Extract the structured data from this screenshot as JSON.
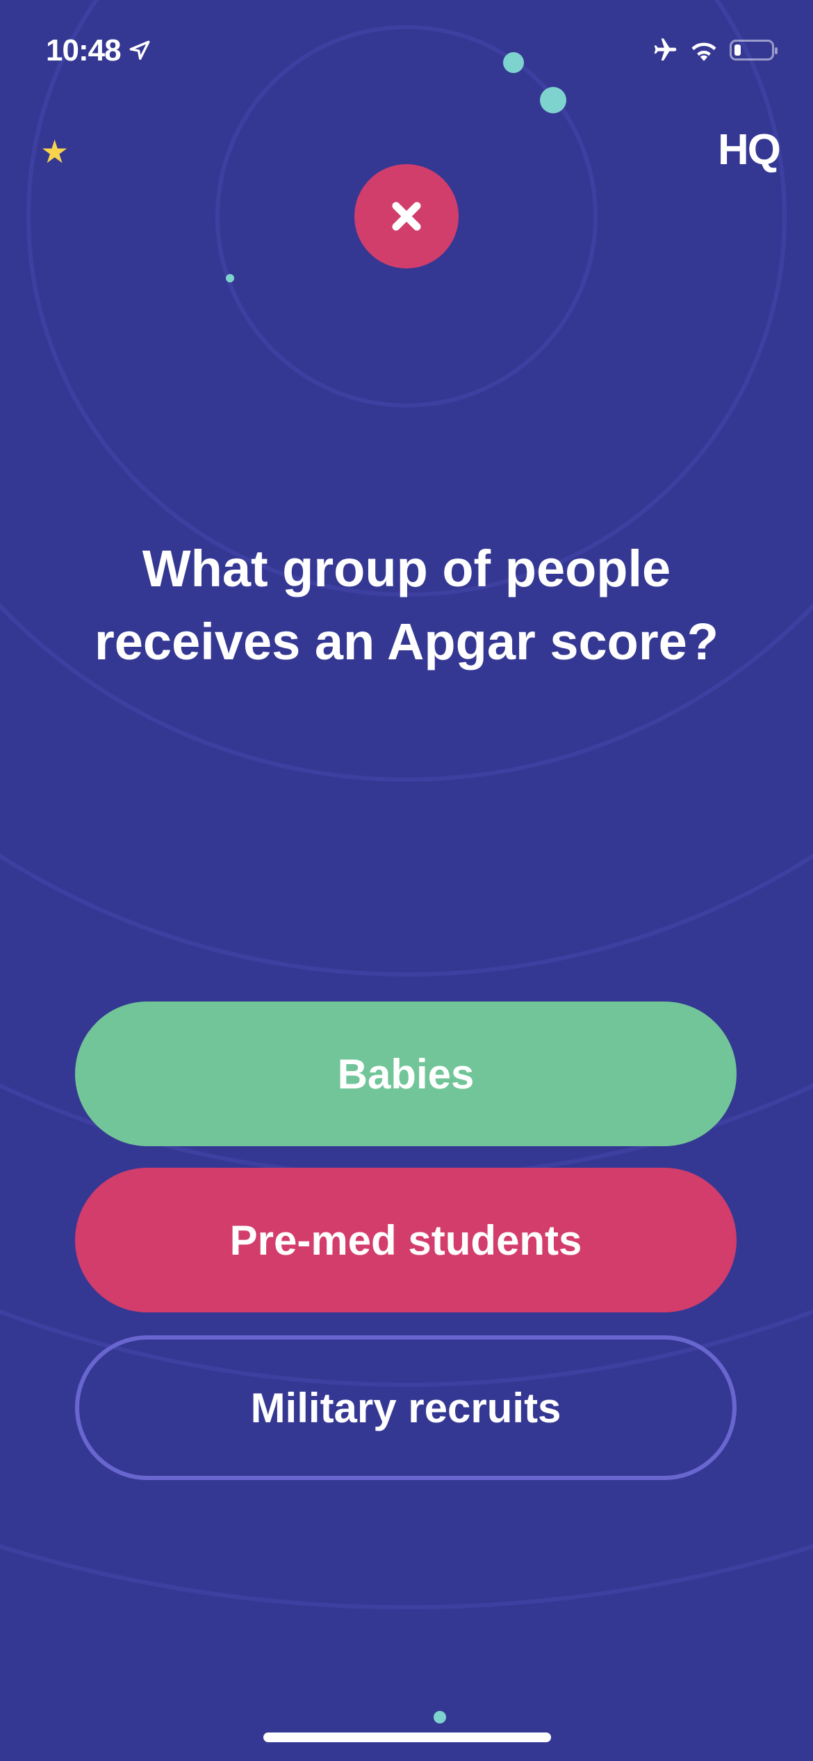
{
  "status_bar": {
    "time": "10:48",
    "icons": [
      "location-arrow-icon",
      "airplane-icon",
      "wifi-icon",
      "battery-icon"
    ],
    "battery_percent": 10
  },
  "header": {
    "logo": "HQ",
    "left_icon": "star-icon"
  },
  "result_icon": "x-icon",
  "question": "What group of people receives an Apgar score?",
  "answers": [
    {
      "label": "Babies",
      "state": "correct"
    },
    {
      "label": "Pre-med students",
      "state": "wrong-selected"
    },
    {
      "label": "Military recruits",
      "state": "neutral"
    }
  ],
  "colors": {
    "background": "#353893",
    "correct": "#72c598",
    "wrong": "#d33d6b",
    "outline": "#6a66d0",
    "accent_dot": "#7fd3cf",
    "star": "#f7d44c"
  }
}
